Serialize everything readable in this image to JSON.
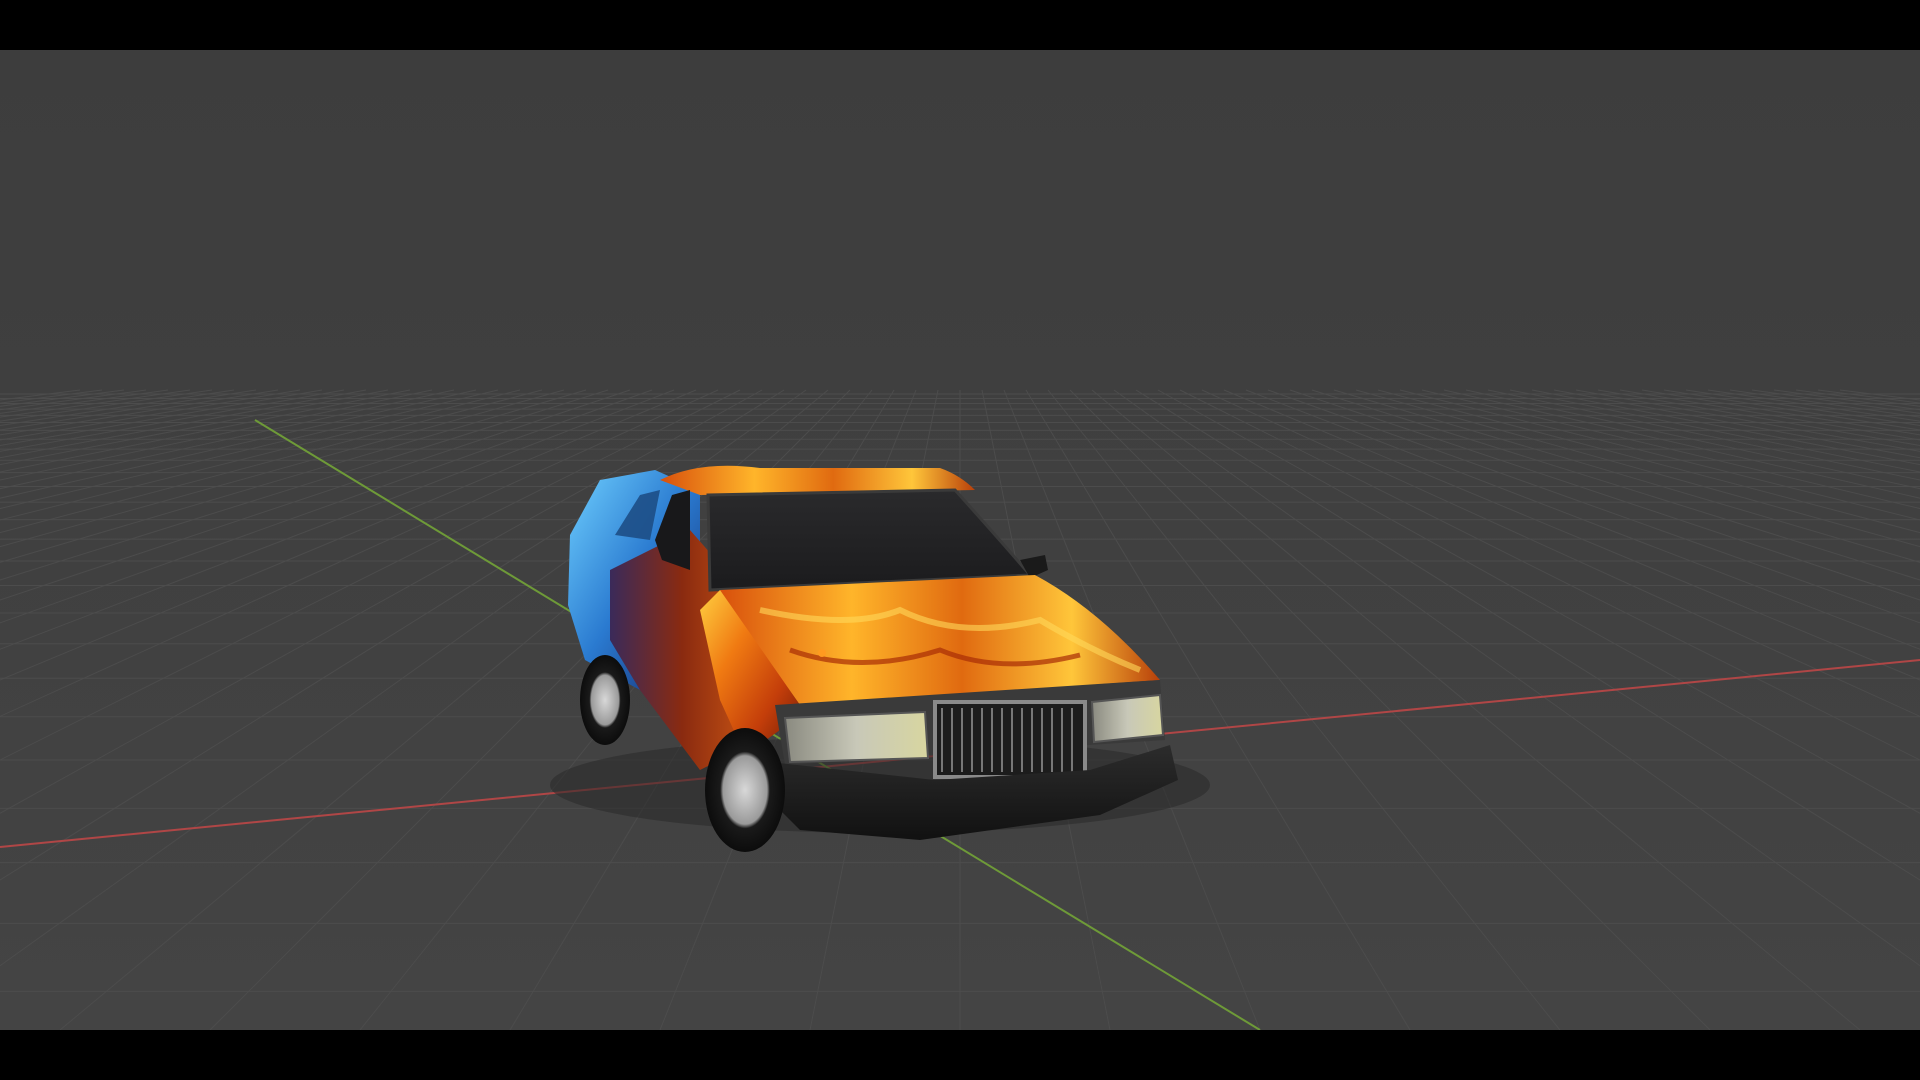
{
  "viewport": {
    "background": "#3d3d3d",
    "letterbox_color": "#000000"
  },
  "grid": {
    "line_color": "#4c4c4c",
    "x_axis_color": "#b04646",
    "y_axis_color": "#6e9a38",
    "visible": true
  },
  "object": {
    "type": "car-model",
    "paint": "flame",
    "paint_colors": [
      "#e85d10",
      "#ffb020",
      "#3aa0e0",
      "#1b3b8c"
    ]
  },
  "origin_marker": {
    "color": "#ff9a20"
  }
}
